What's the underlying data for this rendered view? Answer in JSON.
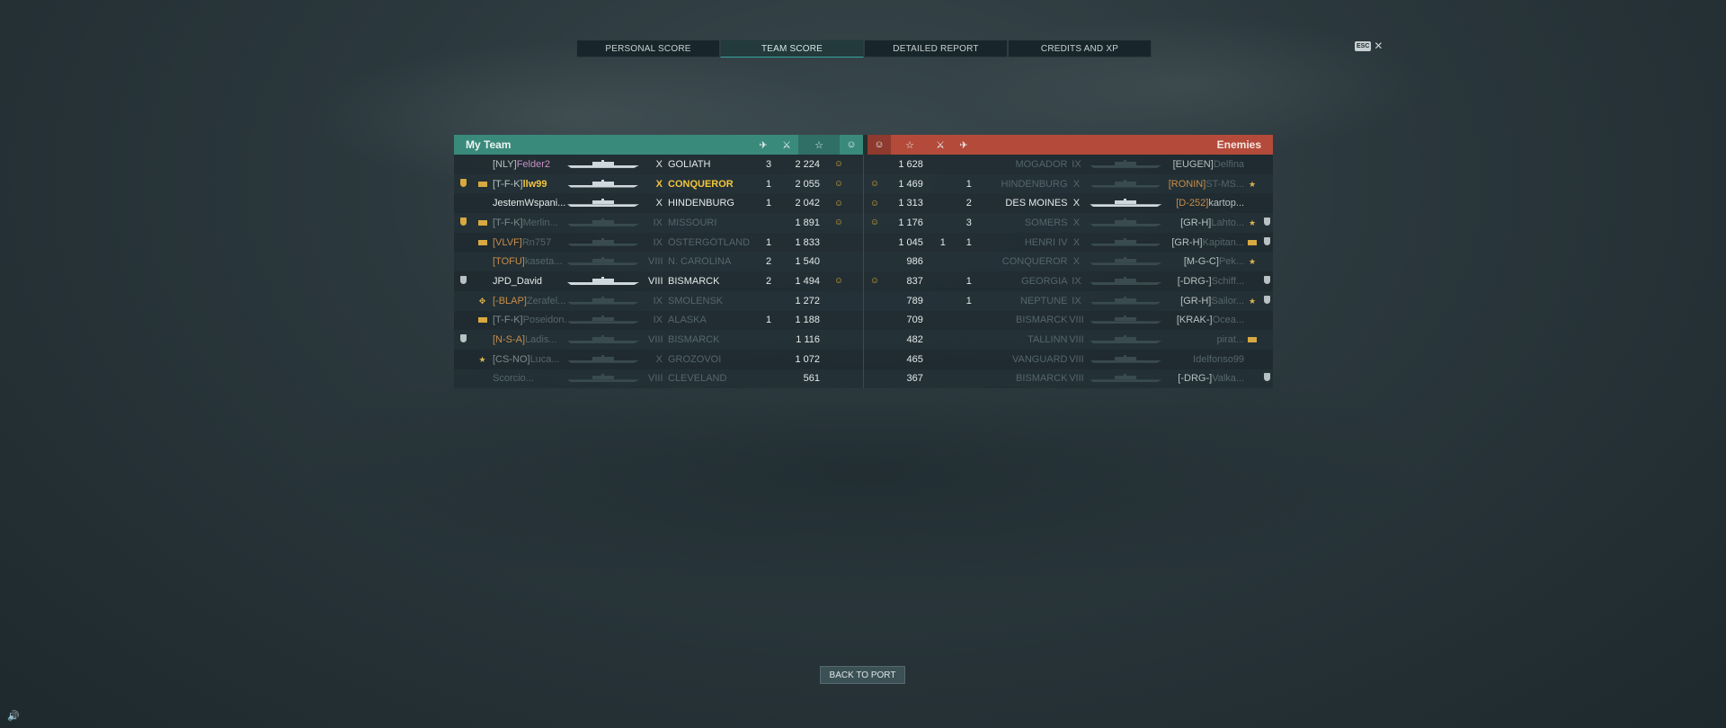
{
  "tabs": [
    {
      "label": "PERSONAL SCORE",
      "active": false
    },
    {
      "label": "TEAM SCORE",
      "active": true
    },
    {
      "label": "DETAILED REPORT",
      "active": false
    },
    {
      "label": "CREDITS AND XP",
      "active": false
    }
  ],
  "esc_label": "ESC",
  "close_glyph": "✕",
  "my_team_title": "My Team",
  "enemies_title": "Enemies",
  "header_icons": {
    "planes": "plane-kill-icon",
    "ships": "ship-kill-icon",
    "xp": "star-icon",
    "smile": "smile-icon"
  },
  "my_team": [
    {
      "rank": "",
      "medal": "",
      "clan": "[NLY]",
      "name": "Felder2",
      "name_style": "pink",
      "tier": "X",
      "ship": "GOLIATH",
      "n": "3",
      "xp": "2 224",
      "smile": true,
      "style": "normal"
    },
    {
      "rank": "gold",
      "medal": "bar",
      "clan": "[T-F-K]",
      "name": "llw99",
      "name_style": "gold",
      "tier": "X",
      "ship": "CONQUEROR",
      "n": "1",
      "xp": "2 055",
      "smile": true,
      "style": "gold"
    },
    {
      "rank": "",
      "medal": "",
      "clan": "",
      "name": "JestemWspani...",
      "name_style": "white",
      "tier": "X",
      "ship": "HINDENBURG",
      "n": "1",
      "xp": "2 042",
      "smile": true,
      "style": "normal"
    },
    {
      "rank": "gold",
      "medal": "bar",
      "clan": "[T-F-K]",
      "name": "Merlin...",
      "name_style": "faded",
      "tier": "IX",
      "ship": "MISSOURI",
      "n": "",
      "xp": "1 891",
      "smile": true,
      "style": "dead"
    },
    {
      "rank": "",
      "medal": "bar",
      "clan": "[VLVF]",
      "name": "Rn757",
      "name_style": "faded",
      "tier": "IX",
      "ship": "ÖSTERGÖTLAND",
      "n": "1",
      "xp": "1 833",
      "smile": false,
      "style": "dead",
      "clan_style": "orange"
    },
    {
      "rank": "",
      "medal": "",
      "clan": "[TOFU]",
      "name": "kaseta...",
      "name_style": "faded",
      "tier": "VIII",
      "ship": "N. CAROLINA",
      "n": "2",
      "xp": "1 540",
      "smile": false,
      "style": "dead",
      "clan_style": "orange"
    },
    {
      "rank": "grey",
      "medal": "",
      "clan": "",
      "name": "JPD_David",
      "name_style": "white",
      "tier": "VIII",
      "ship": "BISMARCK",
      "n": "2",
      "xp": "1 494",
      "smile": true,
      "style": "self"
    },
    {
      "rank": "",
      "medal": "cross",
      "clan": "[-BLAP]",
      "name": "Zerafel...",
      "name_style": "faded",
      "tier": "IX",
      "ship": "SMOLENSK",
      "n": "",
      "xp": "1 272",
      "smile": false,
      "style": "dead",
      "clan_style": "orange"
    },
    {
      "rank": "",
      "medal": "bar",
      "clan": "[T-F-K]",
      "name": "Poseidon...",
      "name_style": "faded",
      "tier": "IX",
      "ship": "ALASKA",
      "n": "1",
      "xp": "1 188",
      "smile": false,
      "style": "dead"
    },
    {
      "rank": "grey",
      "medal": "",
      "clan": "[N-S-A]",
      "name": "Ladis...",
      "name_style": "faded",
      "tier": "VIII",
      "ship": "BISMARCK",
      "n": "",
      "xp": "1 116",
      "smile": false,
      "style": "dead",
      "clan_style": "orange"
    },
    {
      "rank": "",
      "medal": "star",
      "clan": "[CS-NO]",
      "name": "Luca...",
      "name_style": "faded",
      "tier": "X",
      "ship": "GROZOVOI",
      "n": "",
      "xp": "1 072",
      "smile": false,
      "style": "dead"
    },
    {
      "rank": "",
      "medal": "",
      "clan": "",
      "name": "Scorcio...",
      "name_style": "faded",
      "tier": "VIII",
      "ship": "CLEVELAND",
      "n": "",
      "xp": "561",
      "smile": false,
      "style": "dead"
    }
  ],
  "enemies": [
    {
      "smile": false,
      "xp": "1 628",
      "n1": "",
      "n2": "",
      "ship": "MOGADOR",
      "tier": "IX",
      "clan": "[EUGEN]",
      "name": "Delfina",
      "medal": "",
      "rank": "",
      "style": "dead"
    },
    {
      "smile": true,
      "xp": "1 469",
      "n1": "",
      "n2": "1",
      "ship": "HINDENBURG",
      "tier": "X",
      "clan": "[RONIN]",
      "name": "ST-MS...",
      "medal": "star",
      "rank": "",
      "style": "dead",
      "clan_style": "orange"
    },
    {
      "smile": true,
      "xp": "1 313",
      "n1": "",
      "n2": "2",
      "ship": "DES MOINES",
      "tier": "X",
      "clan": "[D-252]",
      "name": "kartop...",
      "medal": "",
      "rank": "",
      "style": "alive",
      "clan_style": "orange"
    },
    {
      "smile": true,
      "xp": "1 176",
      "n1": "",
      "n2": "3",
      "ship": "SOMERS",
      "tier": "X",
      "clan": "[GR-H]",
      "name": "Lahto...",
      "medal": "star",
      "rank": "grey",
      "style": "dead"
    },
    {
      "smile": false,
      "xp": "1 045",
      "n1": "1",
      "n2": "1",
      "ship": "HENRI IV",
      "tier": "X",
      "clan": "[GR-H]",
      "name": "Kapitan...",
      "medal": "bar",
      "rank": "grey",
      "style": "dead"
    },
    {
      "smile": false,
      "xp": "986",
      "n1": "",
      "n2": "",
      "ship": "CONQUEROR",
      "tier": "X",
      "clan": "[M-G-C]",
      "name": "Pek...",
      "medal": "star",
      "rank": "",
      "style": "dead"
    },
    {
      "smile": true,
      "xp": "837",
      "n1": "",
      "n2": "1",
      "ship": "GEORGIA",
      "tier": "IX",
      "clan": "[-DRG-]",
      "name": "Schiff...",
      "medal": "",
      "rank": "grey",
      "style": "dead"
    },
    {
      "smile": false,
      "xp": "789",
      "n1": "",
      "n2": "1",
      "ship": "NEPTUNE",
      "tier": "IX",
      "clan": "[GR-H]",
      "name": "Sailor...",
      "medal": "star",
      "rank": "grey",
      "style": "dead"
    },
    {
      "smile": false,
      "xp": "709",
      "n1": "",
      "n2": "",
      "ship": "BISMARCK",
      "tier": "VIII",
      "clan": "[KRAK-]",
      "name": "Ocea...",
      "medal": "",
      "rank": "",
      "style": "dead"
    },
    {
      "smile": false,
      "xp": "482",
      "n1": "",
      "n2": "",
      "ship": "TALLINN",
      "tier": "VIII",
      "clan": "",
      "name": "pirat...",
      "medal": "bar",
      "rank": "",
      "style": "dead"
    },
    {
      "smile": false,
      "xp": "465",
      "n1": "",
      "n2": "",
      "ship": "VANGUARD",
      "tier": "VIII",
      "clan": "",
      "name": "Idelfonso99",
      "medal": "",
      "rank": "",
      "style": "dead"
    },
    {
      "smile": false,
      "xp": "367",
      "n1": "",
      "n2": "",
      "ship": "BISMARCK",
      "tier": "VIII",
      "clan": "[-DRG-]",
      "name": "Valka...",
      "medal": "",
      "rank": "grey",
      "style": "dead"
    }
  ],
  "back_to_port": "BACK TO PORT",
  "sound_icon": "speaker-icon"
}
